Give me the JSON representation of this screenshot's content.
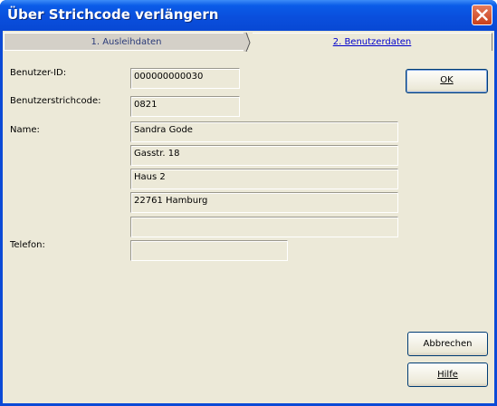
{
  "window": {
    "title": "Über Strichcode verlängern"
  },
  "tabs": [
    {
      "label": "1. Ausleihdaten",
      "active": true
    },
    {
      "label": "2. Benutzerdaten",
      "active": false
    }
  ],
  "form": {
    "user_id_label": "Benutzer-ID:",
    "user_id_value": "000000000030",
    "barcode_label": "Benutzerstrichcode:",
    "barcode_value": "0821",
    "name_label": "Name:",
    "name_lines": [
      "Sandra Gode",
      "Gasstr. 18",
      "Haus 2",
      "22761 Hamburg",
      ""
    ],
    "phone_label": "Telefon:",
    "phone_value": ""
  },
  "buttons": {
    "ok_label": "OK",
    "cancel_label": "Abbrechen",
    "help_label": "Hilfe"
  },
  "icons": {
    "close": "close-icon"
  }
}
